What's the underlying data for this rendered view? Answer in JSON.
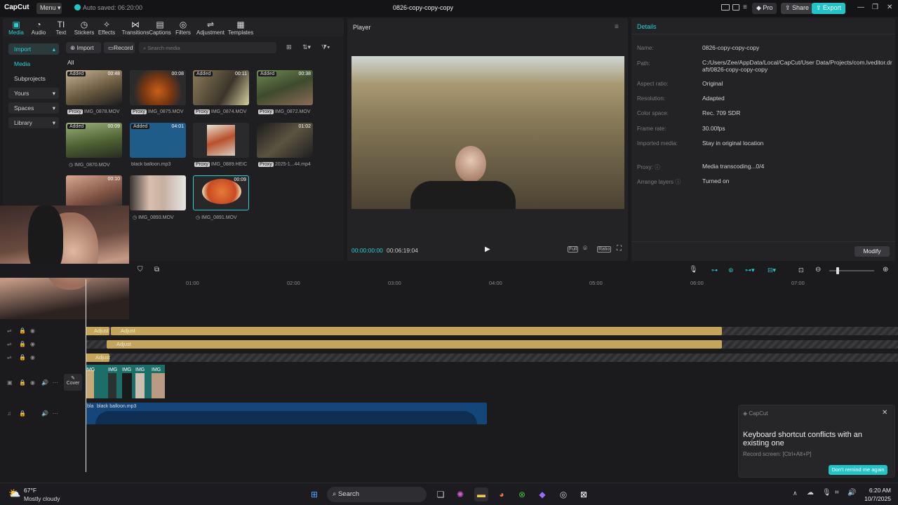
{
  "titlebar": {
    "logo": "CapCut",
    "menu": "Menu",
    "autosave": "Auto saved: 06:20:00",
    "project_title": "0826-copy-copy-copy",
    "pro": "Pro",
    "share": "Share",
    "export": "Export"
  },
  "tools": [
    {
      "label": "Media",
      "icon": "media-icon"
    },
    {
      "label": "Audio",
      "icon": "audio-icon"
    },
    {
      "label": "Text",
      "icon": "text-icon"
    },
    {
      "label": "Stickers",
      "icon": "stickers-icon"
    },
    {
      "label": "Effects",
      "icon": "effects-icon"
    },
    {
      "label": "Transitions",
      "icon": "transitions-icon"
    },
    {
      "label": "Captions",
      "icon": "captions-icon"
    },
    {
      "label": "Filters",
      "icon": "filters-icon"
    },
    {
      "label": "Adjustment",
      "icon": "adjustment-icon"
    },
    {
      "label": "Templates",
      "icon": "templates-icon"
    }
  ],
  "media": {
    "sidebar": [
      "Import",
      "Media",
      "Subprojects",
      "Yours",
      "Spaces",
      "Library"
    ],
    "import_btn": "Import",
    "record_btn": "Record",
    "search_placeholder": "Search media",
    "filter_all": "All",
    "items": [
      {
        "name": "IMG_0878.MOV",
        "duration": "00:48",
        "added": "Added",
        "proxy": "Proxy"
      },
      {
        "name": "IMG_0875.MOV",
        "duration": "00:08",
        "added": "",
        "proxy": "Proxy"
      },
      {
        "name": "IMG_0874.MOV",
        "duration": "00:11",
        "added": "Added",
        "proxy": "Proxy"
      },
      {
        "name": "IMG_0872.MOV",
        "duration": "00:38",
        "added": "Added",
        "proxy": "Proxy"
      },
      {
        "name": "IMG_0870.MOV",
        "duration": "00:09",
        "added": "Added",
        "proxy": ""
      },
      {
        "name": "black balloon.mp3",
        "duration": "04:01",
        "added": "Added",
        "proxy": ""
      },
      {
        "name": "IMG_0889.HEIC",
        "duration": "",
        "added": "",
        "proxy": "Proxy"
      },
      {
        "name": "2025-1...44.mp4",
        "duration": "01:02",
        "added": "",
        "proxy": "Proxy"
      },
      {
        "name": "",
        "duration": "00:10",
        "added": "",
        "proxy": ""
      },
      {
        "name": "IMG_0893.MOV",
        "duration": "",
        "added": "",
        "proxy": ""
      },
      {
        "name": "IMG_0891.MOV",
        "duration": "00:09",
        "added": "",
        "proxy": ""
      }
    ]
  },
  "player": {
    "title": "Player",
    "time_current": "00:00:00:00",
    "time_total": "00:06:19:04",
    "full": "Full",
    "ratio": "Ratio"
  },
  "details": {
    "title": "Details",
    "rows": [
      {
        "label": "Name:",
        "value": "0826-copy-copy-copy"
      },
      {
        "label": "Path:",
        "value": "C:/Users/Zee/AppData/Local/CapCut/User Data/Projects/com.lveditor.draft/0826-copy-copy-copy"
      },
      {
        "label": "Aspect ratio:",
        "value": "Original"
      },
      {
        "label": "Resolution:",
        "value": "Adapted"
      },
      {
        "label": "Color space:",
        "value": "Rec. 709 SDR"
      },
      {
        "label": "Frame rate:",
        "value": "30.00fps"
      },
      {
        "label": "Imported media:",
        "value": "Stay in original location"
      },
      {
        "label": "Proxy:",
        "value": "Media transcoding...0/4"
      },
      {
        "label": "Arrange layers",
        "value": "Turned on"
      }
    ],
    "modify": "Modify"
  },
  "timeline": {
    "ticks": [
      "01:00",
      "02:00",
      "03:00",
      "04:00",
      "05:00",
      "06:00",
      "07:00"
    ],
    "adjust_label": "Adjust",
    "adjust_label2": "Adjust",
    "video_label": "IMG",
    "cover": "Cover",
    "audio_label_short": "bla",
    "audio_label": "black balloon.mp3"
  },
  "notification": {
    "app": "CapCut",
    "message": "Keyboard shortcut conflicts with an existing one",
    "detail": "Record screen: [Ctrl+Alt+P]",
    "button": "Don't remind me again"
  },
  "taskbar": {
    "temp": "67°F",
    "weather": "Mostly cloudy",
    "search": "Search",
    "time": "6:20 AM",
    "date": "10/7/2025"
  },
  "colors": {
    "accent": "#22d3d3",
    "gold": "#c4a55a",
    "audio": "#1b4f86"
  }
}
